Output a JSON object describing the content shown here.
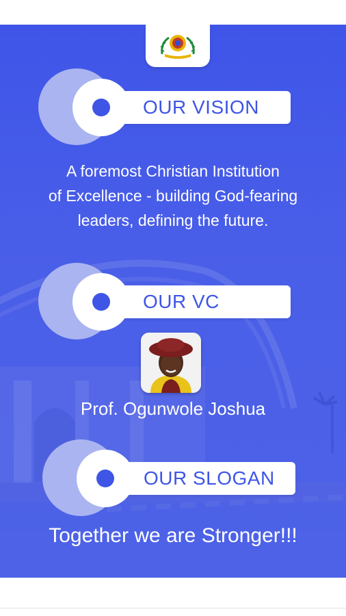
{
  "sections": {
    "vision": {
      "heading": "OUR VISION",
      "text": "A foremost Christian Institution\nof Excellence - building God-fearing\nleaders, defining the future."
    },
    "vc": {
      "heading": "OUR VC",
      "name": "Prof. Ogunwole Joshua"
    },
    "slogan": {
      "heading": "OUR SLOGAN",
      "text": "Together we are Stronger!!!"
    }
  },
  "colors": {
    "background": "#4a5fe8",
    "accent": "#3e55e6",
    "halo": "#aab4f0",
    "logo_gold": "#e8b400",
    "logo_green": "#1e8a3a"
  },
  "icons": {
    "logo": "university-crest-icon",
    "bullet": "circle-dot-icon"
  }
}
